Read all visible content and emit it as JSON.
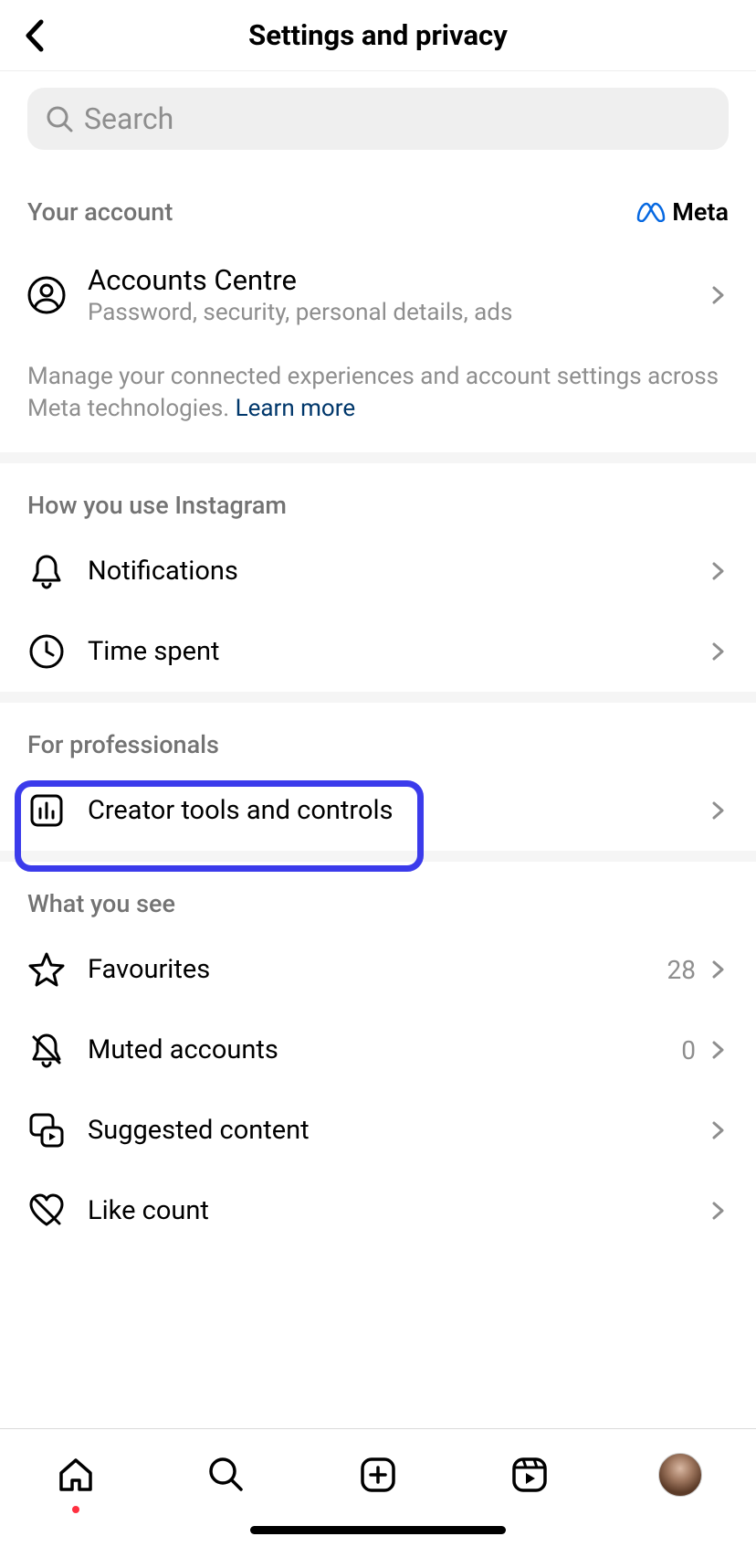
{
  "header": {
    "title": "Settings and privacy"
  },
  "search": {
    "placeholder": "Search"
  },
  "sections": {
    "account": {
      "title": "Your account",
      "brand": "Meta",
      "item": {
        "title": "Accounts Centre",
        "subtitle": "Password, security, personal details, ads"
      },
      "description": "Manage your connected experiences and account settings across Meta technologies. ",
      "learn_more": "Learn more"
    },
    "usage": {
      "title": "How you use Instagram",
      "items": {
        "notifications": "Notifications",
        "time_spent": "Time spent"
      }
    },
    "professionals": {
      "title": "For professionals",
      "items": {
        "creator_tools": "Creator tools and controls"
      }
    },
    "what_you_see": {
      "title": "What you see",
      "items": {
        "favourites": {
          "label": "Favourites",
          "value": "28"
        },
        "muted": {
          "label": "Muted accounts",
          "value": "0"
        },
        "suggested": {
          "label": "Suggested content"
        },
        "like_count": {
          "label": "Like count"
        }
      }
    }
  }
}
